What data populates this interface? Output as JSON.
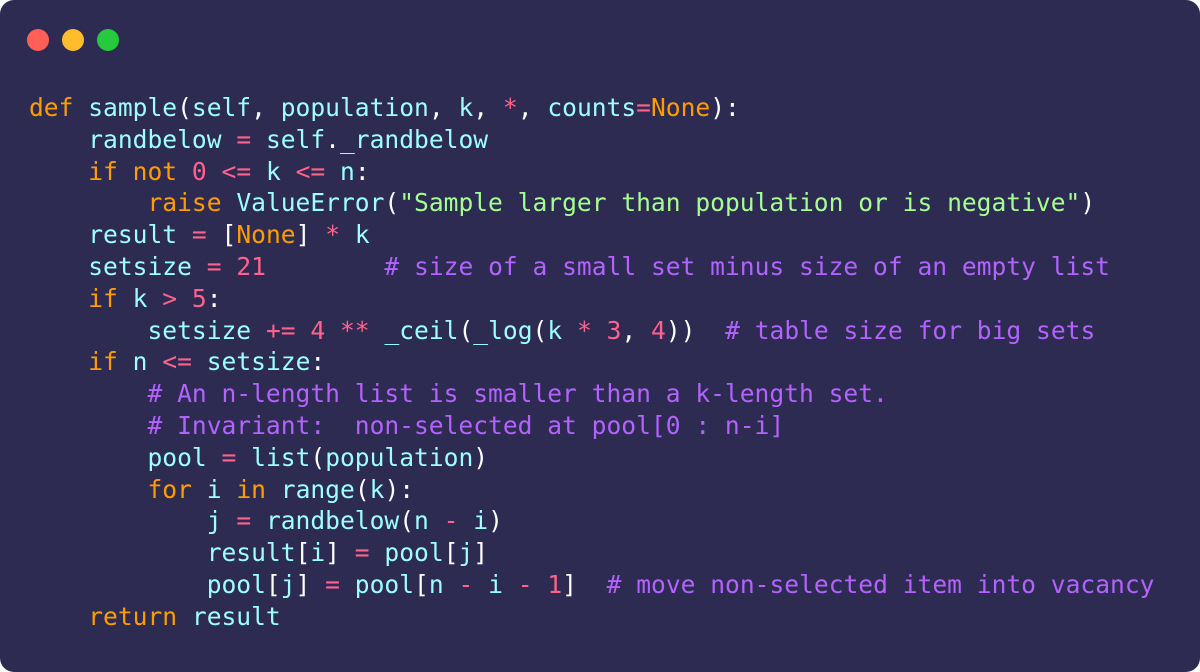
{
  "window": {
    "controls": [
      {
        "name": "close",
        "color": "#ff5f56"
      },
      {
        "name": "minimize",
        "color": "#ffbd2e"
      },
      {
        "name": "maximize",
        "color": "#27c93f"
      }
    ],
    "background": "#2d2b52"
  },
  "code": {
    "language": "python",
    "lines": [
      [
        [
          "kw",
          "def"
        ],
        [
          "ws",
          " "
        ],
        [
          "fn",
          "sample"
        ],
        [
          "pun",
          "("
        ],
        [
          "id",
          "self"
        ],
        [
          "pun",
          ", "
        ],
        [
          "id",
          "population"
        ],
        [
          "pun",
          ", "
        ],
        [
          "id",
          "k"
        ],
        [
          "pun",
          ", "
        ],
        [
          "op",
          "*"
        ],
        [
          "pun",
          ", "
        ],
        [
          "id",
          "counts"
        ],
        [
          "op",
          "="
        ],
        [
          "const",
          "None"
        ],
        [
          "pun",
          "):"
        ]
      ],
      [
        [
          "ws",
          "    "
        ],
        [
          "id",
          "randbelow"
        ],
        [
          "ws",
          " "
        ],
        [
          "op",
          "="
        ],
        [
          "ws",
          " "
        ],
        [
          "id",
          "self"
        ],
        [
          "pun",
          "."
        ],
        [
          "id",
          "_randbelow"
        ]
      ],
      [
        [
          "ws",
          "    "
        ],
        [
          "kw",
          "if"
        ],
        [
          "ws",
          " "
        ],
        [
          "kw",
          "not"
        ],
        [
          "ws",
          " "
        ],
        [
          "num",
          "0"
        ],
        [
          "ws",
          " "
        ],
        [
          "op",
          "<="
        ],
        [
          "ws",
          " "
        ],
        [
          "id",
          "k"
        ],
        [
          "ws",
          " "
        ],
        [
          "op",
          "<="
        ],
        [
          "ws",
          " "
        ],
        [
          "id",
          "n"
        ],
        [
          "pun",
          ":"
        ]
      ],
      [
        [
          "ws",
          "        "
        ],
        [
          "kw",
          "raise"
        ],
        [
          "ws",
          " "
        ],
        [
          "fn",
          "ValueError"
        ],
        [
          "pun",
          "("
        ],
        [
          "str",
          "\"Sample larger than population or is negative\""
        ],
        [
          "pun",
          ")"
        ]
      ],
      [
        [
          "ws",
          "    "
        ],
        [
          "id",
          "result"
        ],
        [
          "ws",
          " "
        ],
        [
          "op",
          "="
        ],
        [
          "ws",
          " "
        ],
        [
          "pun",
          "["
        ],
        [
          "const",
          "None"
        ],
        [
          "pun",
          "]"
        ],
        [
          "ws",
          " "
        ],
        [
          "op",
          "*"
        ],
        [
          "ws",
          " "
        ],
        [
          "id",
          "k"
        ]
      ],
      [
        [
          "ws",
          "    "
        ],
        [
          "id",
          "setsize"
        ],
        [
          "ws",
          " "
        ],
        [
          "op",
          "="
        ],
        [
          "ws",
          " "
        ],
        [
          "num",
          "21"
        ],
        [
          "ws",
          "        "
        ],
        [
          "com",
          "# size of a small set minus size of an empty list"
        ]
      ],
      [
        [
          "ws",
          "    "
        ],
        [
          "kw",
          "if"
        ],
        [
          "ws",
          " "
        ],
        [
          "id",
          "k"
        ],
        [
          "ws",
          " "
        ],
        [
          "op",
          ">"
        ],
        [
          "ws",
          " "
        ],
        [
          "num",
          "5"
        ],
        [
          "pun",
          ":"
        ]
      ],
      [
        [
          "ws",
          "        "
        ],
        [
          "id",
          "setsize"
        ],
        [
          "ws",
          " "
        ],
        [
          "op",
          "+="
        ],
        [
          "ws",
          " "
        ],
        [
          "num",
          "4"
        ],
        [
          "ws",
          " "
        ],
        [
          "op",
          "**"
        ],
        [
          "ws",
          " "
        ],
        [
          "fn",
          "_ceil"
        ],
        [
          "pun",
          "("
        ],
        [
          "fn",
          "_log"
        ],
        [
          "pun",
          "("
        ],
        [
          "id",
          "k"
        ],
        [
          "ws",
          " "
        ],
        [
          "op",
          "*"
        ],
        [
          "ws",
          " "
        ],
        [
          "num",
          "3"
        ],
        [
          "pun",
          ", "
        ],
        [
          "num",
          "4"
        ],
        [
          "pun",
          "))"
        ],
        [
          "ws",
          "  "
        ],
        [
          "com",
          "# table size for big sets"
        ]
      ],
      [
        [
          "ws",
          "    "
        ],
        [
          "kw",
          "if"
        ],
        [
          "ws",
          " "
        ],
        [
          "id",
          "n"
        ],
        [
          "ws",
          " "
        ],
        [
          "op",
          "<="
        ],
        [
          "ws",
          " "
        ],
        [
          "id",
          "setsize"
        ],
        [
          "pun",
          ":"
        ]
      ],
      [
        [
          "ws",
          "        "
        ],
        [
          "com",
          "# An n-length list is smaller than a k-length set."
        ]
      ],
      [
        [
          "ws",
          "        "
        ],
        [
          "com",
          "# Invariant:  non-selected at pool[0 : n-i]"
        ]
      ],
      [
        [
          "ws",
          "        "
        ],
        [
          "id",
          "pool"
        ],
        [
          "ws",
          " "
        ],
        [
          "op",
          "="
        ],
        [
          "ws",
          " "
        ],
        [
          "fn",
          "list"
        ],
        [
          "pun",
          "("
        ],
        [
          "id",
          "population"
        ],
        [
          "pun",
          ")"
        ]
      ],
      [
        [
          "ws",
          "        "
        ],
        [
          "kw",
          "for"
        ],
        [
          "ws",
          " "
        ],
        [
          "id",
          "i"
        ],
        [
          "ws",
          " "
        ],
        [
          "kw",
          "in"
        ],
        [
          "ws",
          " "
        ],
        [
          "fn",
          "range"
        ],
        [
          "pun",
          "("
        ],
        [
          "id",
          "k"
        ],
        [
          "pun",
          "):"
        ]
      ],
      [
        [
          "ws",
          "            "
        ],
        [
          "id",
          "j"
        ],
        [
          "ws",
          " "
        ],
        [
          "op",
          "="
        ],
        [
          "ws",
          " "
        ],
        [
          "fn",
          "randbelow"
        ],
        [
          "pun",
          "("
        ],
        [
          "id",
          "n"
        ],
        [
          "ws",
          " "
        ],
        [
          "op",
          "-"
        ],
        [
          "ws",
          " "
        ],
        [
          "id",
          "i"
        ],
        [
          "pun",
          ")"
        ]
      ],
      [
        [
          "ws",
          "            "
        ],
        [
          "id",
          "result"
        ],
        [
          "pun",
          "["
        ],
        [
          "id",
          "i"
        ],
        [
          "pun",
          "]"
        ],
        [
          "ws",
          " "
        ],
        [
          "op",
          "="
        ],
        [
          "ws",
          " "
        ],
        [
          "id",
          "pool"
        ],
        [
          "pun",
          "["
        ],
        [
          "id",
          "j"
        ],
        [
          "pun",
          "]"
        ]
      ],
      [
        [
          "ws",
          "            "
        ],
        [
          "id",
          "pool"
        ],
        [
          "pun",
          "["
        ],
        [
          "id",
          "j"
        ],
        [
          "pun",
          "]"
        ],
        [
          "ws",
          " "
        ],
        [
          "op",
          "="
        ],
        [
          "ws",
          " "
        ],
        [
          "id",
          "pool"
        ],
        [
          "pun",
          "["
        ],
        [
          "id",
          "n"
        ],
        [
          "ws",
          " "
        ],
        [
          "op",
          "-"
        ],
        [
          "ws",
          " "
        ],
        [
          "id",
          "i"
        ],
        [
          "ws",
          " "
        ],
        [
          "op",
          "-"
        ],
        [
          "ws",
          " "
        ],
        [
          "num",
          "1"
        ],
        [
          "pun",
          "]"
        ],
        [
          "ws",
          "  "
        ],
        [
          "com",
          "# move non-selected item into vacancy"
        ]
      ],
      [
        [
          "ws",
          "    "
        ],
        [
          "kw",
          "return"
        ],
        [
          "ws",
          " "
        ],
        [
          "id",
          "result"
        ]
      ]
    ]
  }
}
